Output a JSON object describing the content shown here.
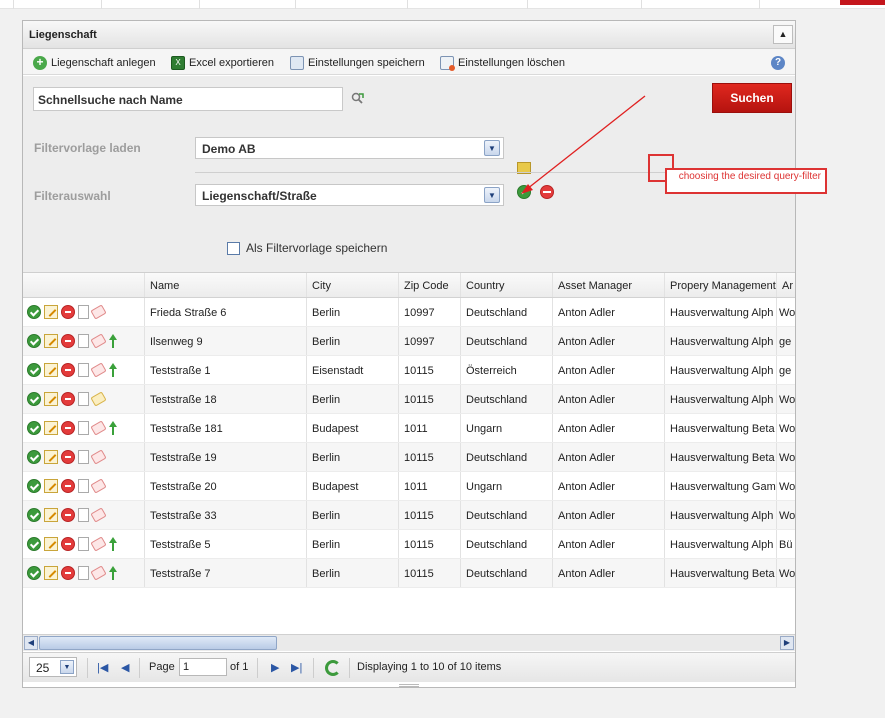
{
  "panel": {
    "title": "Liegenschaft",
    "collapse_icon": "▲"
  },
  "toolbar": {
    "create_label": "Liegenschaft anlegen",
    "excel_label": "Excel exportieren",
    "save_settings_label": "Einstellungen speichern",
    "delete_settings_label": "Einstellungen löschen",
    "help_icon": "?"
  },
  "filter": {
    "search_value": "Schnellsuche nach Name",
    "search_button": "Suchen",
    "template_label": "Filtervorlage laden",
    "template_value": "Demo AB",
    "selection_label": "Filterauswahl",
    "selection_value": "Liegenschaft/Straße",
    "save_as_template_label": "Als Filtervorlage speichern",
    "save_as_template_checked": false,
    "annotation": "choosing the desired query-filter",
    "accent_color": "#c4161c"
  },
  "grid": {
    "columns": [
      "",
      "Name",
      "City",
      "Zip Code",
      "Country",
      "Asset Manager",
      "Propery Management",
      "Ar"
    ],
    "rows": [
      {
        "name": "Frieda Straße 6",
        "city": "Berlin",
        "zip": "10997",
        "country": "Deutschland",
        "asset_manager": "Anton Adler",
        "property_mgmt": "Hausverwaltung Alph",
        "extra": "Wo",
        "tag": "red",
        "up": false
      },
      {
        "name": "Ilsenweg 9",
        "city": "Berlin",
        "zip": "10997",
        "country": "Deutschland",
        "asset_manager": "Anton Adler",
        "property_mgmt": "Hausverwaltung Alph",
        "extra": "ge",
        "tag": "red",
        "up": true
      },
      {
        "name": "Teststraße 1",
        "city": "Eisenstadt",
        "zip": "10115",
        "country": "Österreich",
        "asset_manager": "Anton Adler",
        "property_mgmt": "Hausverwaltung Alph",
        "extra": "ge",
        "tag": "red",
        "up": true
      },
      {
        "name": "Teststraße 18",
        "city": "Berlin",
        "zip": "10115",
        "country": "Deutschland",
        "asset_manager": "Anton Adler",
        "property_mgmt": "Hausverwaltung Alph",
        "extra": "Wo",
        "tag": "yellow",
        "up": false
      },
      {
        "name": "Teststraße 181",
        "city": "Budapest",
        "zip": "1011",
        "country": "Ungarn",
        "asset_manager": "Anton Adler",
        "property_mgmt": "Hausverwaltung Beta",
        "extra": "Wo",
        "tag": "red",
        "up": true
      },
      {
        "name": "Teststraße 19",
        "city": "Berlin",
        "zip": "10115",
        "country": "Deutschland",
        "asset_manager": "Anton Adler",
        "property_mgmt": "Hausverwaltung Beta",
        "extra": "Wo",
        "tag": "red",
        "up": false
      },
      {
        "name": "Teststraße 20",
        "city": "Budapest",
        "zip": "1011",
        "country": "Ungarn",
        "asset_manager": "Anton Adler",
        "property_mgmt": "Hausverwaltung Gam",
        "extra": "Wo",
        "tag": "red",
        "up": false
      },
      {
        "name": "Teststraße 33",
        "city": "Berlin",
        "zip": "10115",
        "country": "Deutschland",
        "asset_manager": "Anton Adler",
        "property_mgmt": "Hausverwaltung Alph",
        "extra": "Wo",
        "tag": "red",
        "up": false
      },
      {
        "name": "Teststraße 5",
        "city": "Berlin",
        "zip": "10115",
        "country": "Deutschland",
        "asset_manager": "Anton Adler",
        "property_mgmt": "Hausverwaltung Alph",
        "extra": "Bü",
        "tag": "red",
        "up": true
      },
      {
        "name": "Teststraße 7",
        "city": "Berlin",
        "zip": "10115",
        "country": "Deutschland",
        "asset_manager": "Anton Adler",
        "property_mgmt": "Hausverwaltung Beta",
        "extra": "Wo",
        "tag": "red",
        "up": true
      }
    ]
  },
  "pager": {
    "page_size": "25",
    "page_label": "Page",
    "page_value": "1",
    "of_label": "of 1",
    "display_text": "Displaying 1 to 10 of 10 items",
    "first_icon": "|◀",
    "prev_icon": "◀",
    "next_icon": "▶",
    "last_icon": "▶|"
  },
  "scrollbar": {
    "left_icon": "◀",
    "right_icon": "▶"
  }
}
